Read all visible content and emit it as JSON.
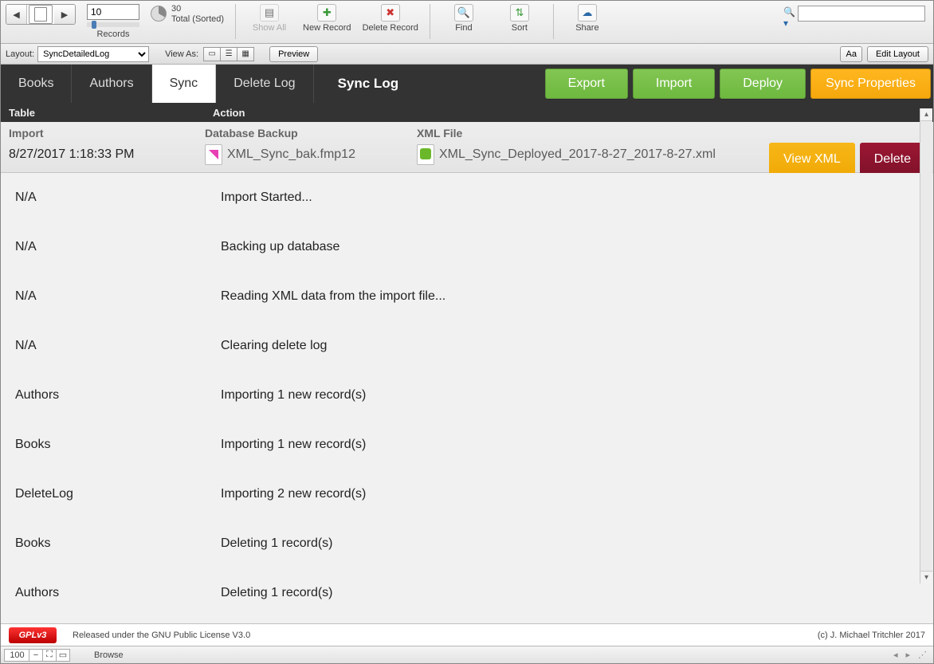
{
  "toolbar": {
    "record_input": "10",
    "records_label": "Records",
    "total_count": "30",
    "total_sorted": "Total (Sorted)",
    "show_all": "Show All",
    "new_record": "New Record",
    "delete_record": "Delete Record",
    "find": "Find",
    "sort": "Sort",
    "share": "Share",
    "search_placeholder": ""
  },
  "layoutbar": {
    "layout_label": "Layout:",
    "layout_value": "SyncDetailedLog",
    "view_as": "View As:",
    "preview": "Preview",
    "aa": "Aa",
    "edit_layout": "Edit Layout"
  },
  "nav": {
    "tabs": [
      "Books",
      "Authors",
      "Sync",
      "Delete Log"
    ],
    "active_index": 2,
    "title": "Sync Log",
    "actions": {
      "export": "Export",
      "import": "Import",
      "deploy": "Deploy",
      "sync_props": "Sync Properties"
    }
  },
  "columns": {
    "table": "Table",
    "action": "Action"
  },
  "subheader": {
    "import_label": "Import",
    "import_value": "8/27/2017 1:18:33 PM",
    "backup_label": "Database Backup",
    "backup_file": "XML_Sync_bak.fmp12",
    "xml_label": "XML File",
    "xml_file": "XML_Sync_Deployed_2017-8-27_2017-8-27.xml",
    "view_xml": "View XML",
    "delete": "Delete"
  },
  "log": [
    {
      "table": "N/A",
      "action": "Import Started..."
    },
    {
      "table": "N/A",
      "action": "Backing up database"
    },
    {
      "table": "N/A",
      "action": "Reading XML data from the import file..."
    },
    {
      "table": "N/A",
      "action": "Clearing delete log"
    },
    {
      "table": "Authors",
      "action": "Importing 1 new record(s)"
    },
    {
      "table": "Books",
      "action": "Importing 1 new record(s)"
    },
    {
      "table": "DeleteLog",
      "action": "Importing 2 new record(s)"
    },
    {
      "table": "Books",
      "action": "Deleting 1 record(s)"
    },
    {
      "table": "Authors",
      "action": "Deleting 1 record(s)"
    }
  ],
  "footer": {
    "license": "Released under the GNU Public License V3.0",
    "gpl": "GPLv3",
    "copyright": "(c) J. Michael Tritchler 2017"
  },
  "status": {
    "zoom": "100",
    "mode": "Browse"
  }
}
